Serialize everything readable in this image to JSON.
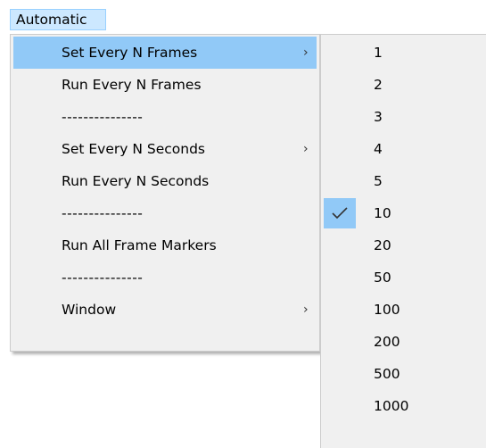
{
  "menubar": {
    "title": "Automatic"
  },
  "main_menu": {
    "items": [
      {
        "label": "Set Every N Frames",
        "submenu": true,
        "arrow": "›"
      },
      {
        "label": "Run Every N Frames"
      },
      {
        "label": "---------------"
      },
      {
        "label": "Set Every N Seconds",
        "submenu": true,
        "arrow": "›"
      },
      {
        "label": "Run Every N Seconds"
      },
      {
        "label": "---------------"
      },
      {
        "label": "Run All Frame Markers"
      },
      {
        "label": "---------------"
      },
      {
        "label": "Window",
        "submenu": true,
        "arrow": "›"
      }
    ]
  },
  "sub_menu": {
    "items": [
      {
        "label": "1"
      },
      {
        "label": "2"
      },
      {
        "label": "3"
      },
      {
        "label": "4"
      },
      {
        "label": "5"
      },
      {
        "label": "10",
        "checked": true
      },
      {
        "label": "20"
      },
      {
        "label": "50"
      },
      {
        "label": "100"
      },
      {
        "label": "200"
      },
      {
        "label": "500"
      },
      {
        "label": "1000"
      }
    ]
  },
  "colors": {
    "highlight": "#91c9f7",
    "menubar_active_bg": "#cce8ff",
    "menu_bg": "#f0f0f0"
  },
  "icons": {
    "submenu_arrow": "chevron-right-icon",
    "check": "check-icon"
  }
}
